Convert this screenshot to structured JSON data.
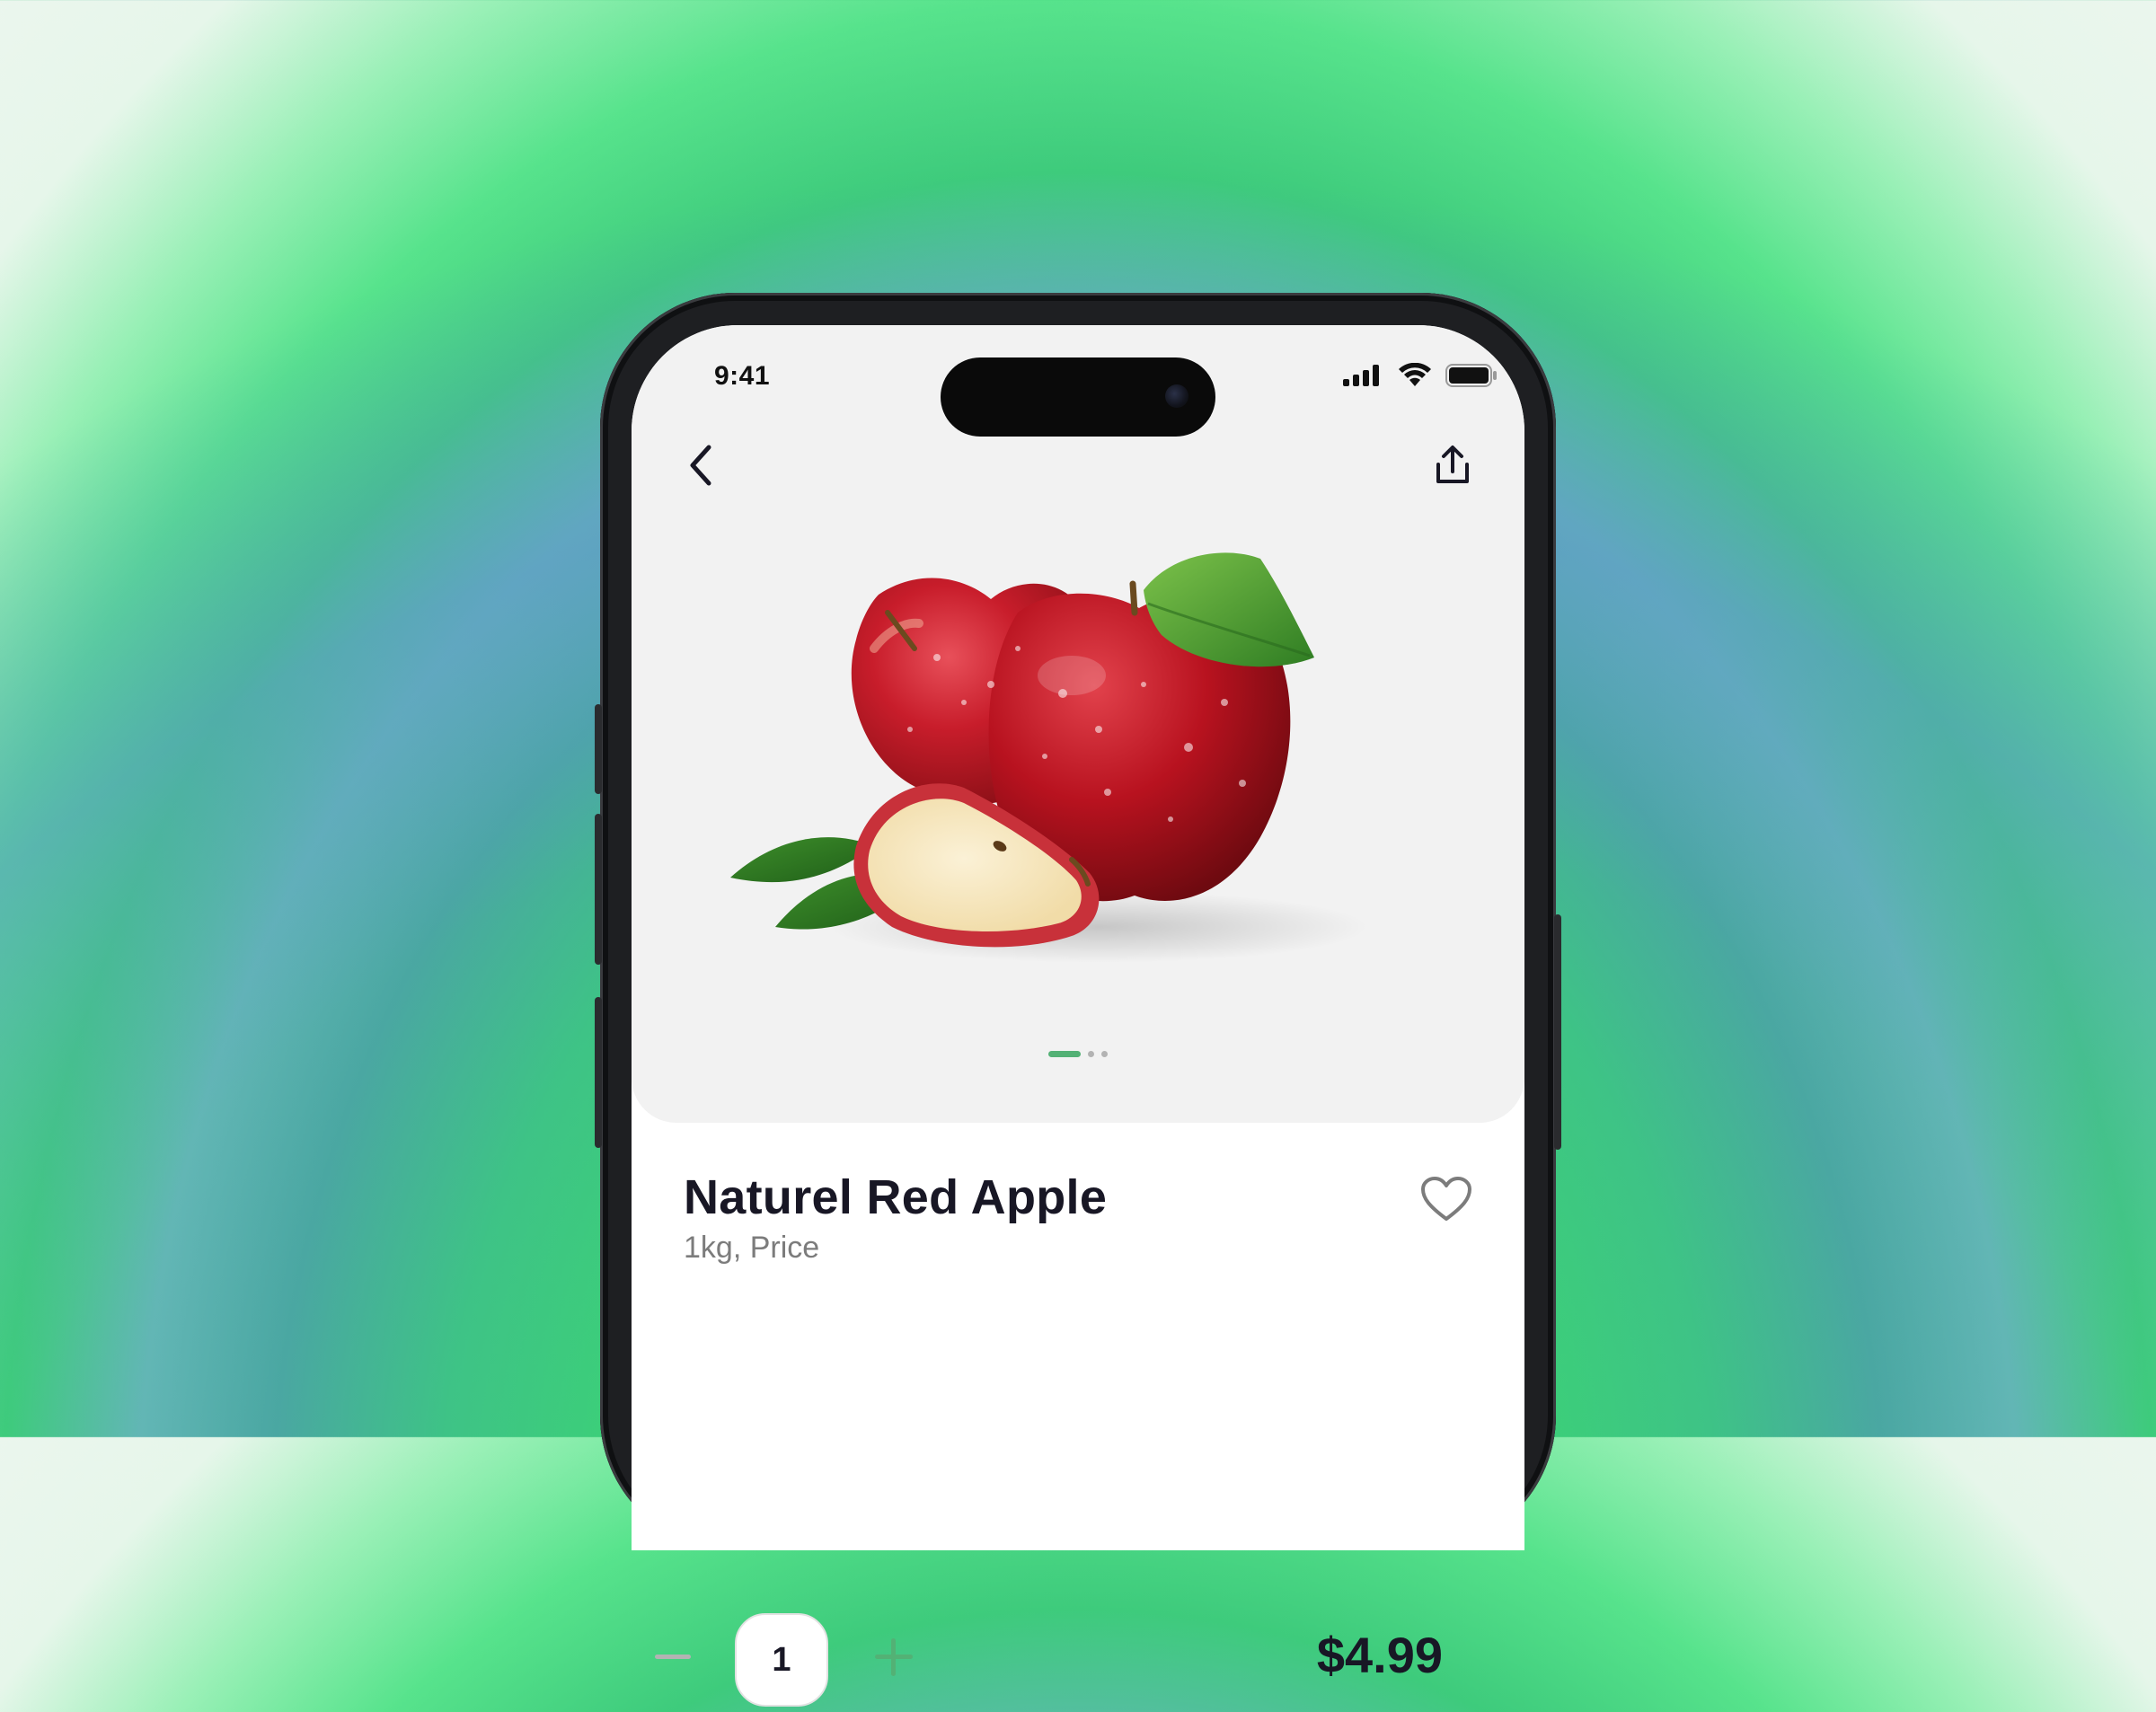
{
  "status_bar": {
    "time": "9:41"
  },
  "icons": {
    "back": "chevron-left-icon",
    "share": "share-icon",
    "favorite": "heart-icon",
    "minus": "minus-icon",
    "plus": "plus-icon",
    "signal": "cellular-signal-icon",
    "wifi": "wifi-icon",
    "battery": "battery-icon"
  },
  "carousel": {
    "total": 3,
    "active": 0
  },
  "product": {
    "title": "Naturel Red Apple",
    "subtitle": "1kg, Price",
    "quantity": "1",
    "price": "$4.99"
  },
  "colors": {
    "accent": "#53B175",
    "title": "#181725",
    "subtitle": "#7C7C7C",
    "hero_bg": "#F2F2F2"
  }
}
